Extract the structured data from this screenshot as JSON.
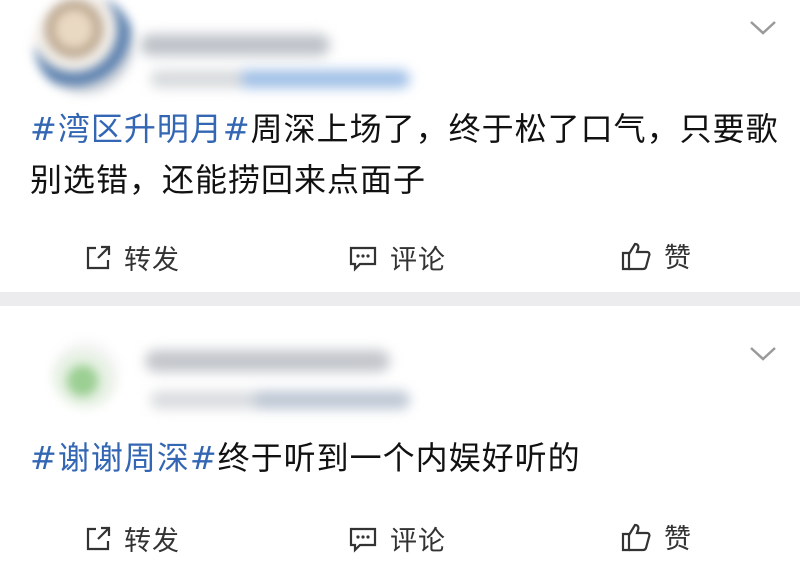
{
  "posts": [
    {
      "hashtag": "#湾区升明月#",
      "text": "周深上场了，终于松了口气，只要歌别选错，还能捞回来点面子",
      "actions": {
        "repost": "转发",
        "comment": "评论",
        "like": "赞"
      }
    },
    {
      "hashtag": "#谢谢周深#",
      "text": "终于听到一个内娱好听的",
      "actions": {
        "repost": "转发",
        "comment": "评论",
        "like": "赞"
      }
    }
  ],
  "icons": {
    "repost": "share-arrow-icon",
    "comment": "comment-bubble-icon",
    "like": "thumbs-up-icon",
    "more": "chevron-down-icon"
  },
  "colors": {
    "hashtag": "#3366b3",
    "text": "#111111",
    "background": "#ececef",
    "card": "#ffffff"
  }
}
